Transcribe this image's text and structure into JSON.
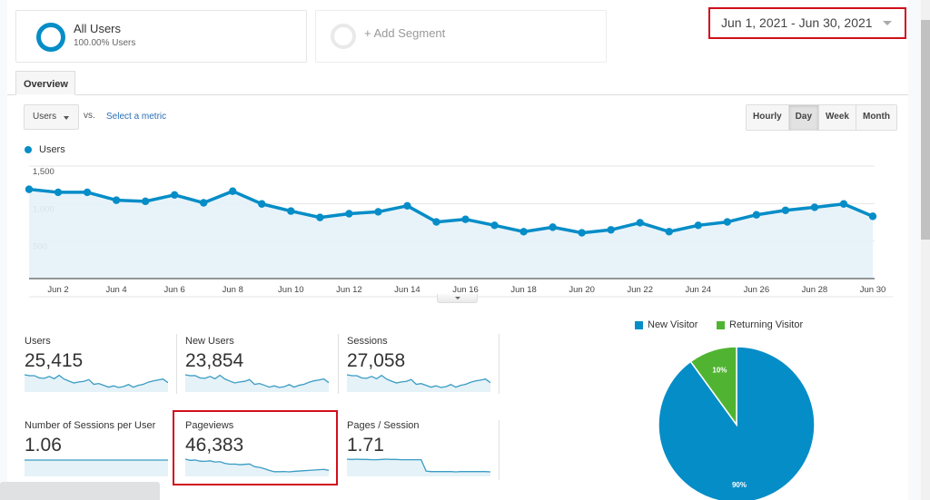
{
  "segments": {
    "all_users": {
      "title": "All Users",
      "subtitle": "100.00% Users"
    },
    "add_segment": {
      "label": "+ Add Segment"
    }
  },
  "date_range": "Jun 1, 2021 - Jun 30, 2021",
  "tabs": [
    {
      "label": "Overview",
      "active": true
    }
  ],
  "metric_selector": {
    "selected": "Users",
    "vs_label": "vs.",
    "select_metric_link": "Select a metric"
  },
  "granularity": [
    {
      "label": "Hourly",
      "active": false
    },
    {
      "label": "Day",
      "active": true
    },
    {
      "label": "Week",
      "active": false
    },
    {
      "label": "Month",
      "active": false
    }
  ],
  "colors": {
    "accent": "#058dc7",
    "returning": "#50b432",
    "highlight": "#d0101a",
    "area_fill": "#e5f2f8"
  },
  "chart_data": [
    {
      "type": "area",
      "title": "",
      "legend": [
        "Users"
      ],
      "legend_position": "top-left",
      "x": [
        "Jun 1",
        "Jun 2",
        "Jun 3",
        "Jun 4",
        "Jun 5",
        "Jun 6",
        "Jun 7",
        "Jun 8",
        "Jun 9",
        "Jun 10",
        "Jun 11",
        "Jun 12",
        "Jun 13",
        "Jun 14",
        "Jun 15",
        "Jun 16",
        "Jun 17",
        "Jun 18",
        "Jun 19",
        "Jun 20",
        "Jun 21",
        "Jun 22",
        "Jun 23",
        "Jun 24",
        "Jun 25",
        "Jun 26",
        "Jun 27",
        "Jun 28",
        "Jun 29",
        "Jun 30"
      ],
      "series": [
        {
          "name": "Users",
          "values": [
            1190,
            1150,
            1150,
            1045,
            1030,
            1115,
            1010,
            1165,
            995,
            900,
            815,
            865,
            890,
            970,
            755,
            790,
            710,
            625,
            685,
            610,
            650,
            745,
            625,
            710,
            755,
            850,
            910,
            950,
            995,
            830
          ]
        }
      ],
      "x_tick_labels": [
        "Jun 2",
        "Jun 4",
        "Jun 6",
        "Jun 8",
        "Jun 10",
        "Jun 12",
        "Jun 14",
        "Jun 16",
        "Jun 18",
        "Jun 20",
        "Jun 22",
        "Jun 24",
        "Jun 26",
        "Jun 28",
        "Jun 30"
      ],
      "y_tick_labels": [
        "500",
        "1,000",
        "1,500"
      ],
      "y_ticks": [
        500,
        1000,
        1500
      ],
      "ylim": [
        0,
        1500
      ],
      "grid": true,
      "xlabel": "",
      "ylabel": ""
    },
    {
      "type": "pie",
      "legend": [
        "New Visitor",
        "Returning Visitor"
      ],
      "legend_position": "top",
      "categories": [
        "New Visitor",
        "Returning Visitor"
      ],
      "values": [
        90,
        10
      ],
      "labels": [
        "90%",
        "10%"
      ]
    }
  ],
  "scorecards": [
    {
      "label": "Users",
      "value": "25,415",
      "spark": [
        1190,
        1150,
        1150,
        1045,
        1030,
        1115,
        1010,
        1165,
        995,
        900,
        815,
        865,
        890,
        970,
        755,
        790,
        710,
        625,
        685,
        610,
        650,
        745,
        625,
        710,
        755,
        850,
        910,
        950,
        995,
        830
      ]
    },
    {
      "label": "New Users",
      "value": "23,854",
      "spark": [
        1120,
        1080,
        1085,
        985,
        970,
        1050,
        950,
        1100,
        940,
        850,
        770,
        815,
        840,
        915,
        710,
        745,
        670,
        590,
        645,
        575,
        610,
        700,
        590,
        670,
        710,
        800,
        860,
        895,
        940,
        780
      ]
    },
    {
      "label": "Sessions",
      "value": "27,058",
      "spark": [
        1270,
        1225,
        1225,
        1115,
        1100,
        1190,
        1075,
        1240,
        1060,
        960,
        870,
        920,
        950,
        1035,
        805,
        840,
        755,
        665,
        730,
        650,
        690,
        795,
        665,
        755,
        805,
        905,
        970,
        1010,
        1060,
        885
      ]
    },
    {
      "label": "Number of Sessions per User",
      "value": "1.06",
      "spark": [
        1.06,
        1.06,
        1.06,
        1.06,
        1.06,
        1.06,
        1.06,
        1.06,
        1.06,
        1.06,
        1.06,
        1.06,
        1.06,
        1.06,
        1.06,
        1.06,
        1.06,
        1.06,
        1.06,
        1.06,
        1.06,
        1.06,
        1.06,
        1.06,
        1.06,
        1.06,
        1.06,
        1.06,
        1.06,
        1.06
      ]
    },
    {
      "label": "Pageviews",
      "value": "46,383",
      "spark": [
        2050,
        1980,
        2000,
        1930,
        1920,
        1950,
        1880,
        1900,
        1800,
        1750,
        1760,
        1720,
        1740,
        1760,
        1600,
        1560,
        1480,
        1380,
        1300,
        1300,
        1310,
        1290,
        1320,
        1340,
        1360,
        1380,
        1400,
        1420,
        1440,
        1380
      ]
    },
    {
      "label": "Pages / Session",
      "value": "1.71",
      "spark": [
        1.95,
        1.94,
        1.95,
        1.94,
        1.94,
        1.93,
        1.93,
        1.94,
        1.95,
        1.94,
        1.94,
        1.93,
        1.93,
        1.93,
        1.93,
        1.93,
        1.52,
        1.5,
        1.5,
        1.5,
        1.5,
        1.5,
        1.49,
        1.5,
        1.5,
        1.5,
        1.5,
        1.5,
        1.5,
        1.49
      ]
    }
  ]
}
